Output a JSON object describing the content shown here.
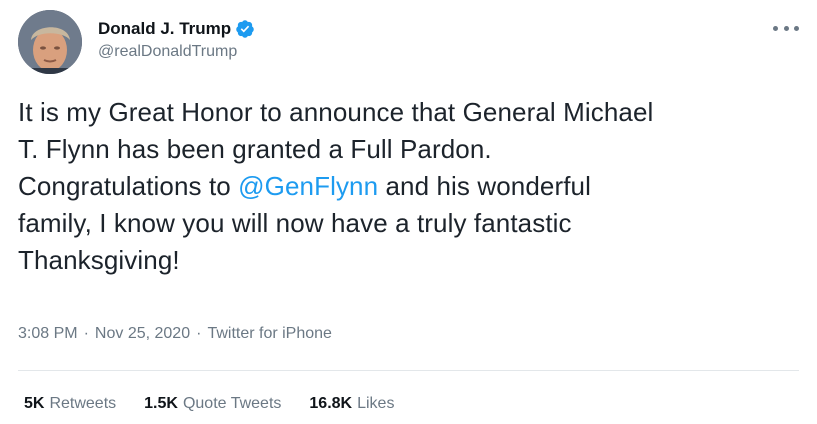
{
  "author": {
    "display_name": "Donald J. Trump",
    "handle": "@realDonaldTrump",
    "verified": true,
    "verified_color": "#1d9bf0"
  },
  "tweet": {
    "line1": "It is my Great Honor to announce that General Michael",
    "line2": "T. Flynn has been granted a Full Pardon.",
    "line3_before": "Congratulations to ",
    "line3_mention": "@GenFlynn",
    "line3_after": " and his wonderful",
    "line4": "family, I know you will now have a truly fantastic",
    "line5": "Thanksgiving!"
  },
  "meta": {
    "time": "3:08 PM",
    "separator": "·",
    "date": "Nov 25, 2020",
    "source": "Twitter for iPhone"
  },
  "stats": {
    "retweets_count": "5K",
    "retweets_label": "Retweets",
    "quotes_count": "1.5K",
    "quotes_label": "Quote Tweets",
    "likes_count": "16.8K",
    "likes_label": "Likes"
  },
  "colors": {
    "mention": "#1d9bf0",
    "secondary_text": "#6b7884"
  },
  "icons": {
    "verified": "verified-badge-icon",
    "more": "more-horizontal-icon"
  }
}
